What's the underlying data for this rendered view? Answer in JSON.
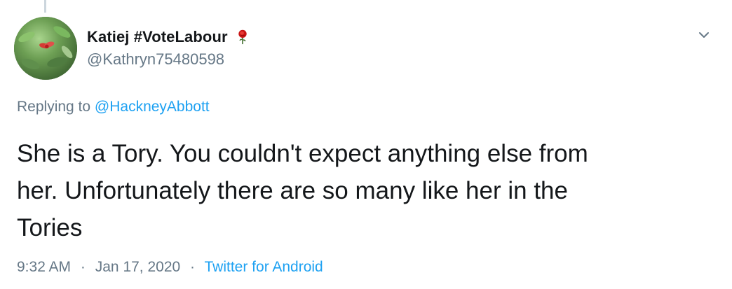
{
  "colors": {
    "text": "#14171a",
    "muted": "#657786",
    "link": "#1da1f2",
    "rose": "#c91515",
    "stem": "#3d6b2a"
  },
  "user": {
    "display_name": "Katiej #VoteLabour",
    "emoji": "rose-icon",
    "handle": "@Kathryn75480598"
  },
  "reply": {
    "prefix": "Replying to",
    "to": "@HackneyAbbott"
  },
  "tweet": {
    "lines": [
      "She is a Tory. You couldn't expect anything else from",
      "her. Unfortunately there are so many like her in the",
      "Tories"
    ]
  },
  "meta": {
    "time": "9:32 AM",
    "separator": "·",
    "date": "Jan 17, 2020",
    "source": "Twitter for Android"
  },
  "icons": {
    "menu": "chevron-down-icon",
    "avatar": "avatar"
  }
}
